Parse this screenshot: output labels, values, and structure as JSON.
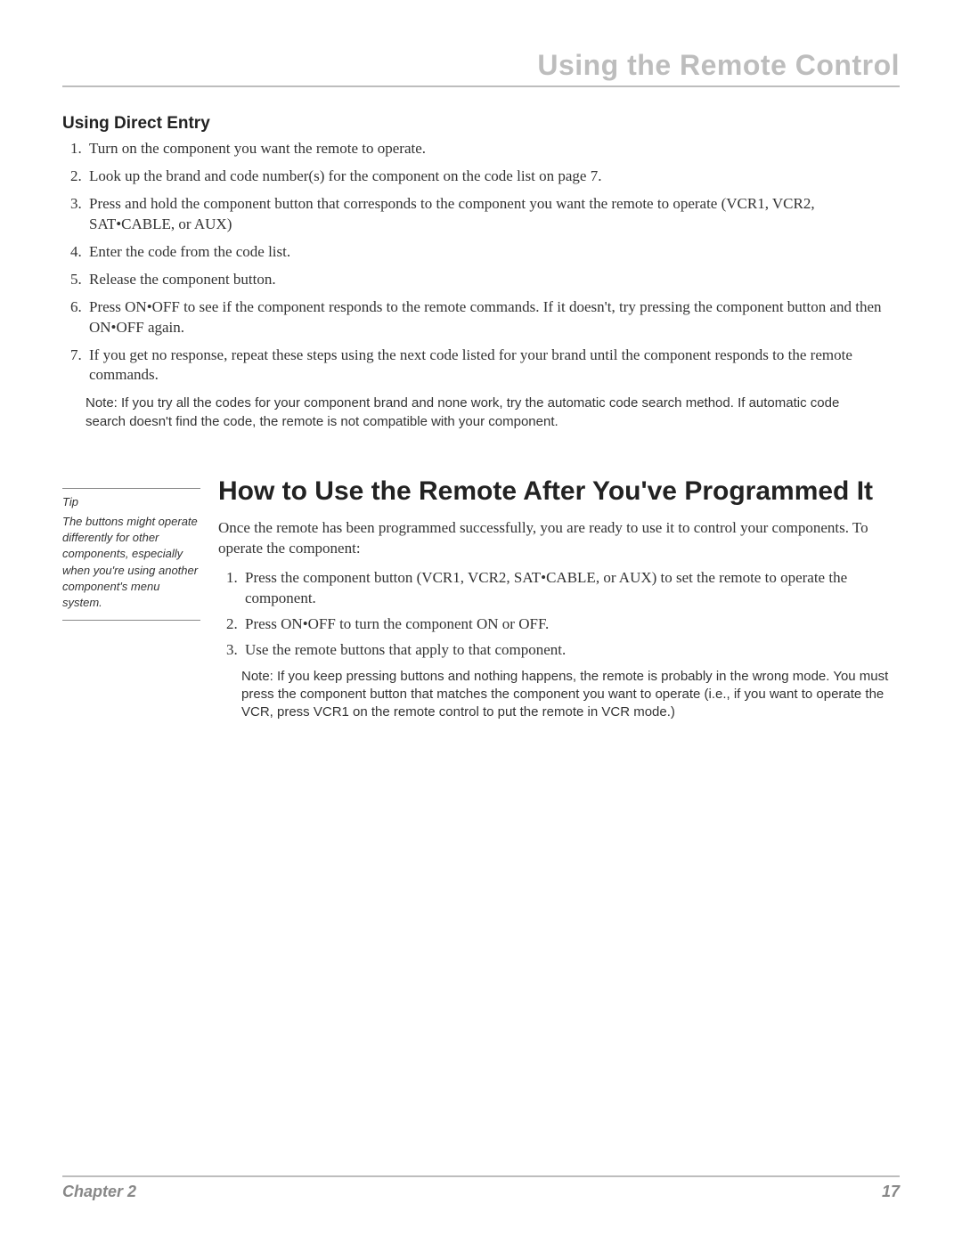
{
  "header": {
    "title": "Using the Remote Control"
  },
  "section1": {
    "title": "Using Direct Entry",
    "steps": [
      "Turn on the component you want the remote to operate.",
      "Look up the brand and code number(s) for the component on the code list on page 7.",
      "Press and hold the component button that corresponds to the component you want the remote to operate (VCR1, VCR2, SAT•CABLE, or AUX)",
      "Enter the code from the code list.",
      "Release the component button.",
      "Press ON•OFF to see if the component responds to the remote commands. If it doesn't, try pressing the component button and then ON•OFF again.",
      "If you get no response, repeat these steps using the next code listed for your brand until the component responds to the remote commands."
    ],
    "note": "Note: If you try all the codes for your component brand and none work, try the automatic code search method. If automatic code search doesn't find the code, the remote is not compatible with your component."
  },
  "tip": {
    "label": "Tip",
    "text": "The buttons might operate differently for other components, especially when you're using another component's menu system."
  },
  "section2": {
    "heading": "How to Use the Remote After You've Programmed It",
    "intro": "Once the remote has been programmed successfully, you are ready to use it to control your components. To operate the component:",
    "steps": [
      "Press the component button (VCR1, VCR2, SAT•CABLE, or AUX) to set the remote to operate the component.",
      "Press ON•OFF to turn the component ON or OFF.",
      "Use the remote buttons that apply to that component."
    ],
    "note": "Note: If you keep pressing buttons and nothing happens, the remote is probably in the wrong mode. You must press the component button that matches the component you want to operate (i.e., if you want to operate the VCR, press VCR1 on the remote control to put the remote in VCR mode.)"
  },
  "footer": {
    "left": "Chapter 2",
    "right": "17"
  }
}
